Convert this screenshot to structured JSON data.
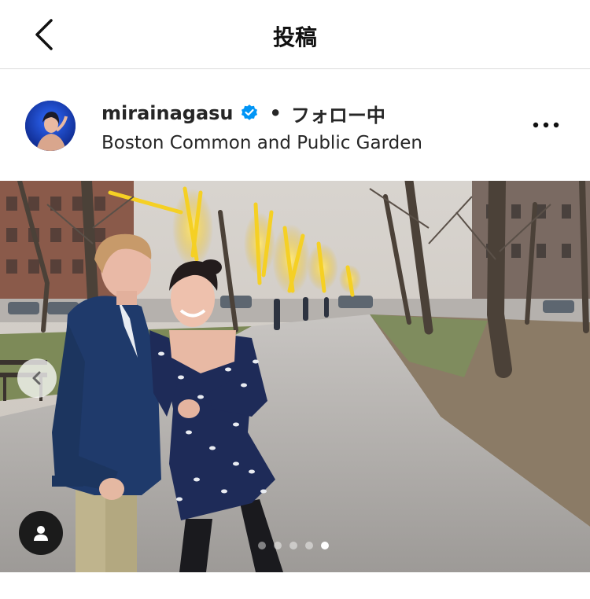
{
  "header": {
    "title": "投稿",
    "back_icon": "chevron-left-icon"
  },
  "post": {
    "username": "mirainagasu",
    "verified": true,
    "separator": "•",
    "follow_status": "フォロー中",
    "location": "Boston Common and Public Garden",
    "more_icon": "more-horizontal-icon"
  },
  "carousel": {
    "slide_count": 5,
    "active_index": 4,
    "prev_icon": "chevron-left-icon",
    "tag_icon": "user-icon"
  },
  "colors": {
    "verified_blue": "#0095f6",
    "divider": "#dbdbdb",
    "text": "#262626"
  }
}
